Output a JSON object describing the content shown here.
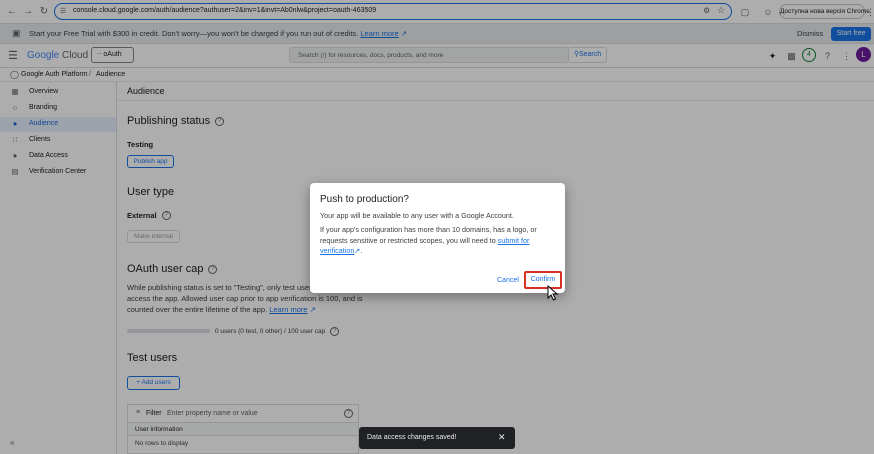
{
  "browser": {
    "url": "console.cloud.google.com/auth/audience?authuser=2&inv=1&invt=Ab0nlw&project=oauth-463509",
    "update_label": "Доступна нова версія Chrome"
  },
  "banner": {
    "message": "Start your Free Trial with $300 in credit. Don't worry—you won't be charged if you run out of credits.",
    "learn_more": "Learn more",
    "dismiss": "Dismiss",
    "start_free": "Start free"
  },
  "header": {
    "logo_google": "Google",
    "logo_cloud": "Cloud",
    "project": "oAuth",
    "search_placeholder": "Search (/) for resources, docs, products, and more",
    "search_button": "Search",
    "notification_count": "4",
    "avatar_letter": "L"
  },
  "breadcrumb": {
    "root": "Google Auth Platform",
    "separator": "/",
    "current": "Audience"
  },
  "sidebar": {
    "items": [
      {
        "label": "Overview",
        "icon": "grid-icon"
      },
      {
        "label": "Branding",
        "icon": "palette-icon"
      },
      {
        "label": "Audience",
        "icon": "person-icon"
      },
      {
        "label": "Clients",
        "icon": "key-icon"
      },
      {
        "label": "Data Access",
        "icon": "shield-icon"
      },
      {
        "label": "Verification Center",
        "icon": "checklist-icon"
      }
    ],
    "active_index": 2
  },
  "main": {
    "page_title": "Audience",
    "publishing_status": {
      "heading": "Publishing status",
      "status": "Testing",
      "button": "Publish app"
    },
    "user_type": {
      "heading": "User type",
      "type": "External",
      "button": "Make internal"
    },
    "user_cap": {
      "heading": "OAuth user cap",
      "description": "While publishing status is set to \"Testing\", only test users are able to access the app. Allowed user cap prior to app verification is 100, and is counted over the entire lifetime of the app.",
      "learn_more": "Learn more",
      "cap_text": "0 users (0 test, 0 other) / 100 user cap",
      "cap_fraction": 0
    },
    "test_users": {
      "heading": "Test users",
      "add_button": "+ Add users",
      "filter_label": "Filter",
      "filter_placeholder": "Enter property name or value",
      "column": "User information",
      "empty": "No rows to display"
    }
  },
  "dialog": {
    "title": "Push to production?",
    "p1": "Your app will be available to any user with a Google Account.",
    "p2": "If your app's configuration has more than 10 domains, has a logo, or requests sensitive or restricted scopes, you will need to",
    "link": "submit for verification",
    "p2_end": ".",
    "cancel": "Cancel",
    "confirm": "Confirm"
  },
  "snackbar": {
    "message": "Data access changes saved!"
  },
  "colors": {
    "accent": "#1a73e8",
    "confirm_highlight": "#d93025",
    "avatar": "#6a1b9a",
    "notification": "#188038"
  }
}
